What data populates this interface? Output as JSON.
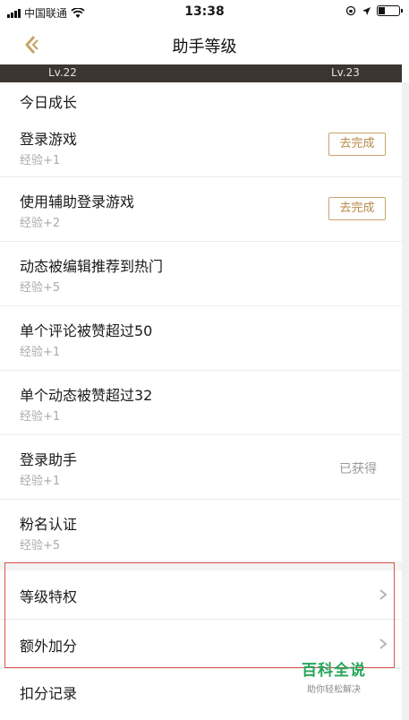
{
  "status_bar": {
    "carrier": "中国联通",
    "time": "13:38",
    "battery_level": 0.3
  },
  "nav": {
    "title": "助手等级"
  },
  "level": {
    "current": "Lv.22",
    "next": "Lv.23"
  },
  "section_title": "今日成长",
  "tasks": [
    {
      "name": "登录游戏",
      "exp": "经验+1",
      "action": "去完成"
    },
    {
      "name": "使用辅助登录游戏",
      "exp": "经验+2",
      "action": "去完成"
    },
    {
      "name": "动态被编辑推荐到热门",
      "exp": "经验+5"
    },
    {
      "name": "单个评论被赞超过50",
      "exp": "经验+1"
    },
    {
      "name": "单个动态被赞超过32",
      "exp": "经验+1"
    },
    {
      "name": "登录助手",
      "exp": "经验+1",
      "status": "已获得"
    },
    {
      "name": "粉名认证",
      "exp": "经验+5"
    }
  ],
  "menu": [
    {
      "label": "等级特权"
    },
    {
      "label": "额外加分"
    },
    {
      "label": "扣分记录"
    }
  ],
  "watermark": {
    "title": "百科全说",
    "subtitle": "助你轻松解决"
  },
  "colors": {
    "accent_gold": "#b8894a",
    "level_bar": "#3a3531",
    "highlight_red": "#d9534f",
    "watermark_green": "#26a65b"
  }
}
